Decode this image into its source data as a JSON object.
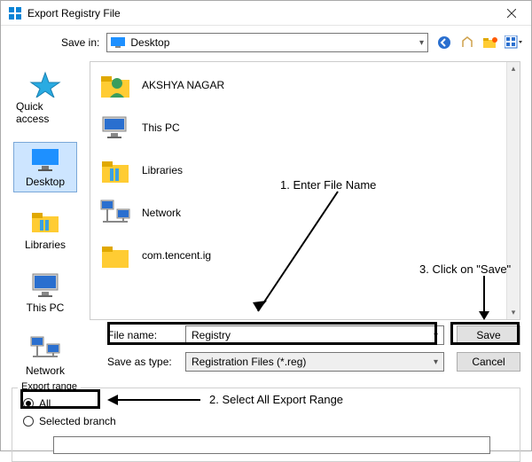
{
  "window": {
    "title": "Export Registry File"
  },
  "toolbar": {
    "save_in_label": "Save in:",
    "save_in_value": "Desktop"
  },
  "places": [
    {
      "label": "Quick access"
    },
    {
      "label": "Desktop"
    },
    {
      "label": "Libraries"
    },
    {
      "label": "This PC"
    },
    {
      "label": "Network"
    }
  ],
  "listing": [
    {
      "name": "AKSHYA NAGAR"
    },
    {
      "name": "This PC"
    },
    {
      "name": "Libraries"
    },
    {
      "name": "Network"
    },
    {
      "name": "com.tencent.ig"
    }
  ],
  "fields": {
    "filename_label": "File name:",
    "filename_value": "Registry",
    "savetype_label": "Save as type:",
    "savetype_value": "Registration Files (*.reg)",
    "save_btn": "Save",
    "cancel_btn": "Cancel"
  },
  "export": {
    "legend": "Export range",
    "opt_all": "All",
    "opt_selected": "Selected branch",
    "branch_value": ""
  },
  "annotations": {
    "step1": "1. Enter File Name",
    "step2": "2. Select All Export Range",
    "step3": "3. Click on \"Save\""
  }
}
